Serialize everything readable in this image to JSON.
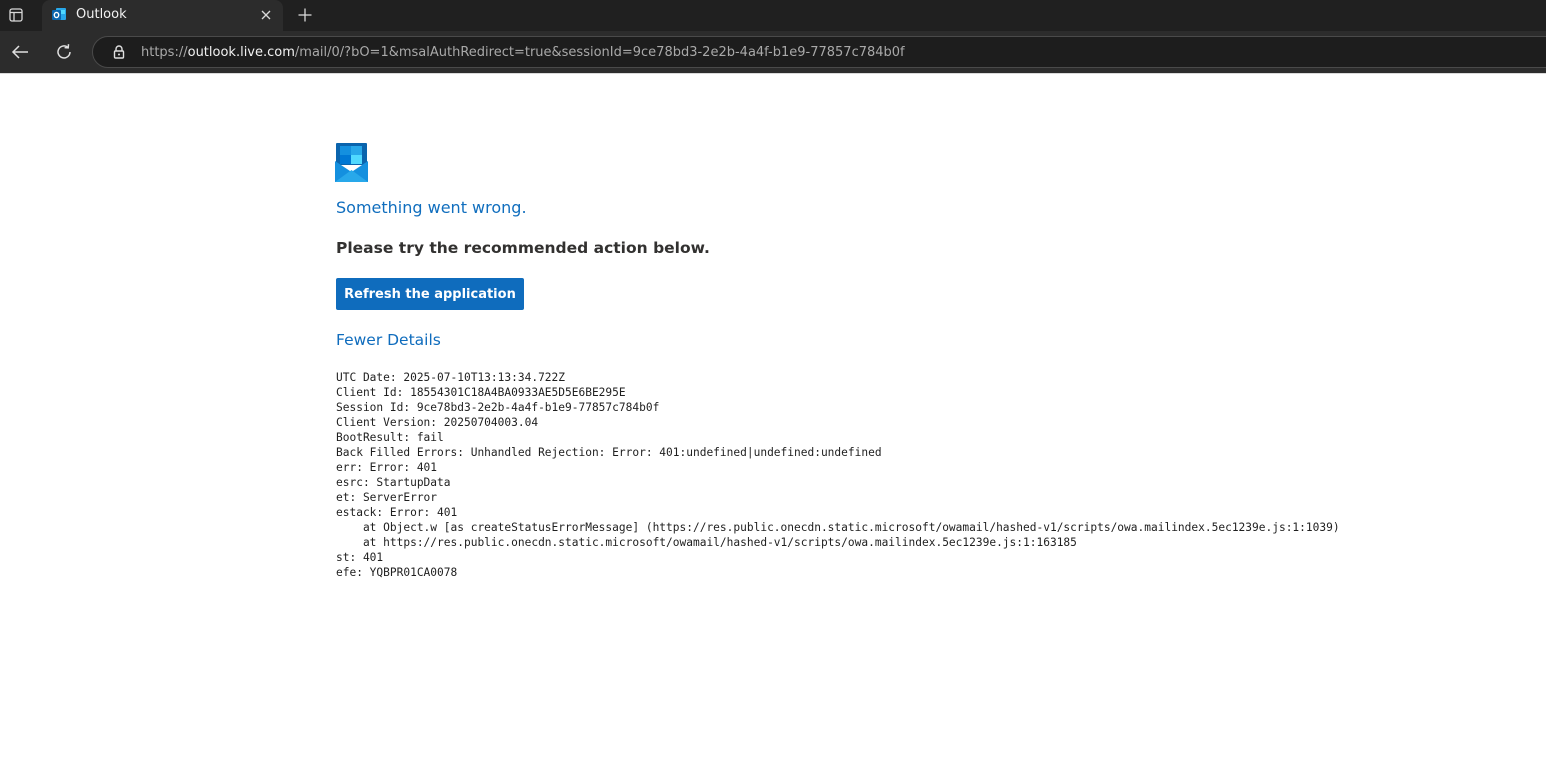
{
  "browser": {
    "tab": {
      "title": "Outlook"
    },
    "address_bar": {
      "scheme": "https://",
      "host": "outlook.live.com",
      "path": "/mail/0/?bO=1&msalAuthRedirect=true&sessionId=9ce78bd3-2e2b-4a4f-b1e9-77857c784b0f"
    },
    "icons": {
      "tab_actions": "tab-actions-icon",
      "favicon": "outlook-icon",
      "close": "close-icon",
      "new_tab": "plus-icon",
      "back": "back-arrow-icon",
      "refresh": "refresh-icon",
      "lock": "lock-icon"
    }
  },
  "page": {
    "logo": "outlook-mail-logo",
    "heading": "Something went wrong.",
    "subheading": "Please try the recommended action below.",
    "refresh_button": "Refresh the application",
    "details_toggle": "Fewer Details",
    "details": [
      "UTC Date: 2025-07-10T13:13:34.722Z",
      "Client Id: 18554301C18A4BA0933AE5D5E6BE295E",
      "Session Id: 9ce78bd3-2e2b-4a4f-b1e9-77857c784b0f",
      "Client Version: 20250704003.04",
      "BootResult: fail",
      "Back Filled Errors: Unhandled Rejection: Error: 401:undefined|undefined:undefined",
      "err: Error: 401",
      "esrc: StartupData",
      "et: ServerError",
      "estack: Error: 401",
      "    at Object.w [as createStatusErrorMessage] (https://res.public.onecdn.static.microsoft/owamail/hashed-v1/scripts/owa.mailindex.5ec1239e.js:1:1039)",
      "    at https://res.public.onecdn.static.microsoft/owamail/hashed-v1/scripts/owa.mailindex.5ec1239e.js:1:163185",
      "st: 401",
      "efe: YQBPR01CA0078"
    ]
  },
  "colors": {
    "accent": "#0f6cbd",
    "heading": "#106ebe",
    "chrome_dark": "#202020",
    "chrome_tab": "#2c2c2c"
  }
}
